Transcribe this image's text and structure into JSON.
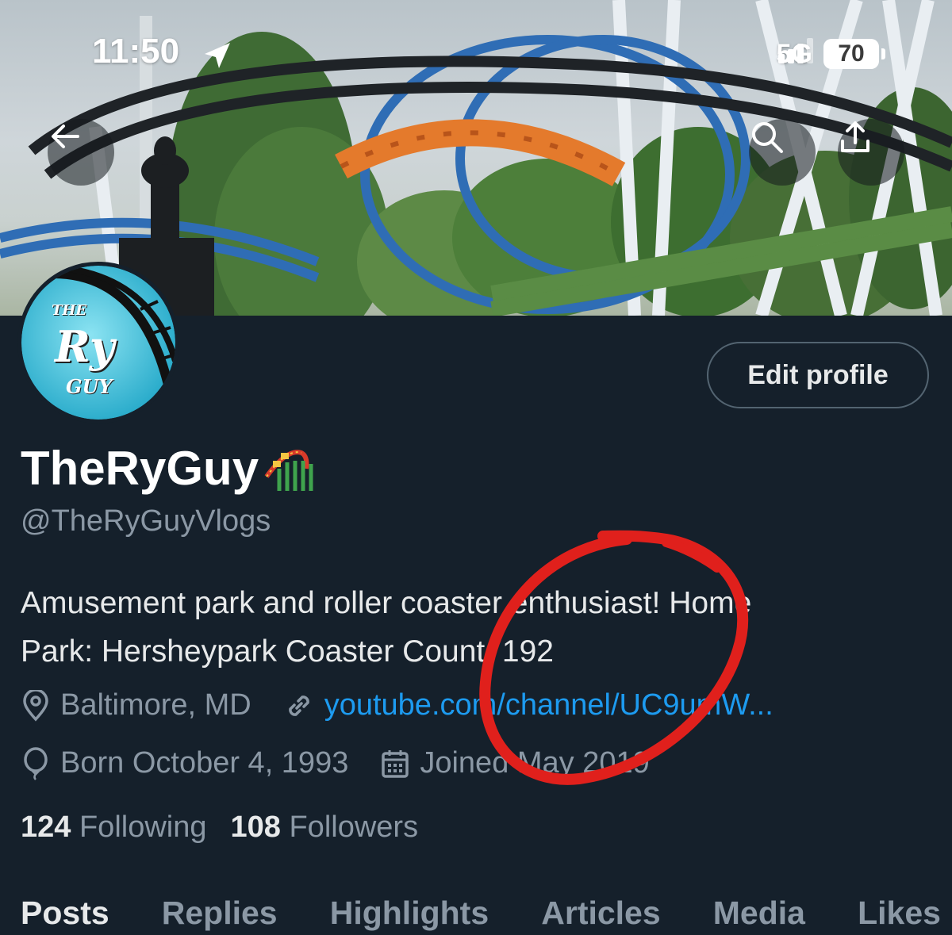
{
  "status_bar": {
    "time": "11:50",
    "location_icon": "location-arrow-icon",
    "signal_icon": "signal-bars-icon",
    "network": "5G",
    "battery": "70"
  },
  "header": {
    "back_icon": "back-arrow-icon",
    "search_icon": "search-icon",
    "share_icon": "share-icon",
    "banner_icon": "roller-coaster-banner-image"
  },
  "avatar": {
    "line1": "THE",
    "line2": "Ry",
    "line3": "GUY",
    "color": "#4fc3d9"
  },
  "edit_profile_label": "Edit profile",
  "profile": {
    "name": "TheRyGuy",
    "name_emoji": "🎢",
    "handle": "@TheRyGuyVlogs",
    "bio_line1": "Amusement park and roller coaster enthusiast! Home",
    "bio_line2": "Park: Hersheypark Coaster Count: 192",
    "location": "Baltimore, MD",
    "link": "youtube.com/channel/UC9umW...",
    "birthday": "Born October 4, 1993",
    "joined": "Joined May 2019"
  },
  "counts": {
    "following_num": "124",
    "following_label": "Following",
    "followers_num": "108",
    "followers_label": "Followers"
  },
  "tabs": [
    "Posts",
    "Replies",
    "Highlights",
    "Articles",
    "Media",
    "Likes"
  ],
  "colors": {
    "background": "#15202b",
    "link": "#1d9bf0",
    "secondary_text": "#8b98a5",
    "annotation": "#e0201c"
  }
}
